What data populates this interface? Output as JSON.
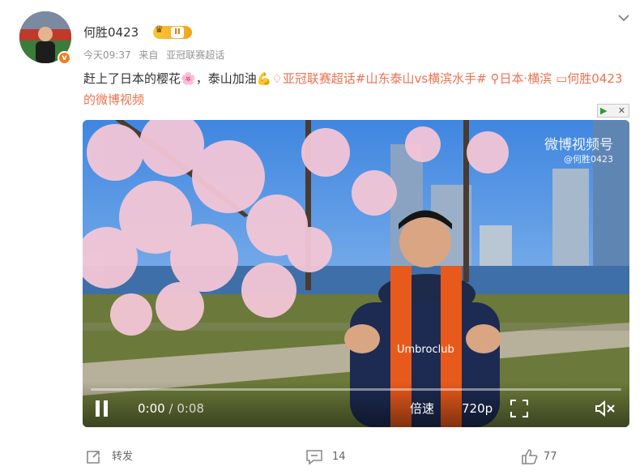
{
  "post": {
    "username": "何胜0423",
    "level_badge": "II",
    "verified_mark": "v",
    "time": "今天09:37",
    "source_prefix": "来自",
    "source": "亚冠联赛超话",
    "text_part1": "赶上了日本的樱花",
    "text_emoji1": "🌸",
    "text_part2": "，泰山加油",
    "text_emoji2": "💪",
    "topic": "亚冠联赛超话",
    "hashtag": "#山东泰山vs横滨水手#",
    "location": "日本·横滨",
    "video_link": "何胜0423的微博视频"
  },
  "video": {
    "watermark_title": "微博视频号",
    "watermark_sub": "@何胜0423",
    "current_time": "0:00",
    "separator": "/",
    "duration": "0:08",
    "speed_label": "倍速",
    "quality_label": "720p",
    "progress_fraction": 0.0,
    "scarf_text": "Umbroclub",
    "ad_close": "✕"
  },
  "actions": {
    "repost_label": "转发",
    "comment_count": "14",
    "like_count": "77"
  },
  "icons": {
    "chevron": "chevron-down-icon",
    "repost": "share-icon",
    "comment": "comment-icon",
    "like": "thumbs-up-icon",
    "play_pause": "pause-icon",
    "fullscreen": "fullscreen-icon",
    "mute": "mute-icon",
    "topic": "diamond-topic-icon",
    "location": "location-pin-icon",
    "video": "video-icon"
  },
  "colors": {
    "link": "#eb7350",
    "meta": "#939393",
    "badge": "#f57c1f"
  }
}
